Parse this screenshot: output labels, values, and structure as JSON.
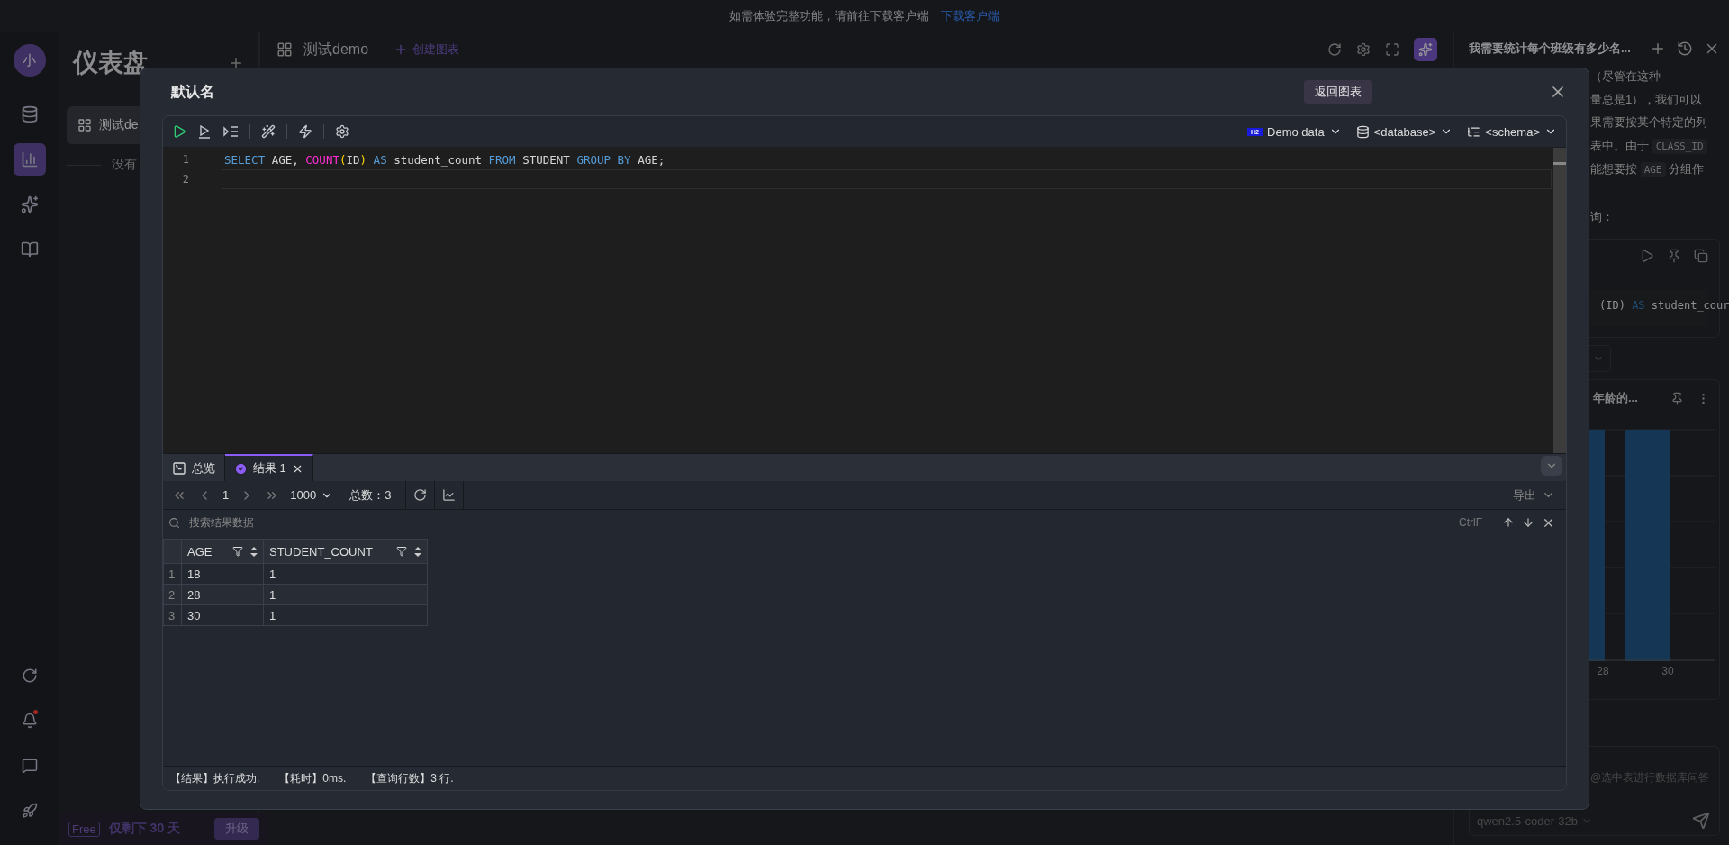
{
  "banner": {
    "text": "如需体验完整功能，请前往下载客户端",
    "link": "下载客户端"
  },
  "rail": {
    "avatar": "小",
    "items": [
      {
        "kind": "database",
        "selected": false
      },
      {
        "kind": "chart",
        "selected": true
      },
      {
        "kind": "assistant",
        "selected": false
      },
      {
        "kind": "book",
        "selected": false
      }
    ],
    "bottom_items": [
      {
        "kind": "refresh",
        "notification": false
      },
      {
        "kind": "bell",
        "notification": true
      },
      {
        "kind": "message",
        "notification": false
      },
      {
        "kind": "rocket",
        "notification": false
      }
    ]
  },
  "sidebar": {
    "title": "仪表盘",
    "items": [
      {
        "label": "测试de",
        "selected": true
      }
    ],
    "empty_text": "没有",
    "plan": {
      "tag": "Free",
      "text": "仅剩下 30 天",
      "button": "升级"
    }
  },
  "header": {
    "title": "测试demo",
    "create": "创建图表"
  },
  "assistant": {
    "title": "我需要统计每个班级有多少名...",
    "message_lines": [
      [
        {
          "text": "（尽管在这种",
          "kind": "text"
        }
      ],
      [
        {
          "text": "量总是1），我们可以",
          "kind": "text"
        }
      ],
      [
        {
          "text": "果需要按某个特定的列",
          "kind": "text"
        }
      ],
      [
        {
          "text": "表中。由于 ",
          "kind": "text"
        },
        {
          "text": "CLASS_ID",
          "kind": "code"
        }
      ],
      [
        {
          "text": "能想要按 ",
          "kind": "text"
        },
        {
          "text": "AGE",
          "kind": "code"
        },
        {
          "text": " 分组作",
          "kind": "text"
        }
      ],
      [
        {
          "text": "询：",
          "kind": "text"
        }
      ]
    ],
    "snippet": [
      {
        "text": "(ID) ",
        "kind": "plain"
      },
      {
        "text": "AS",
        "kind": "keyword"
      },
      {
        "text": " student_cour",
        "kind": "plain"
      }
    ],
    "chart": {
      "title": "年龄的...",
      "x_labels": [
        "28",
        "30"
      ]
    },
    "input": {
      "placeholder": "@选中表进行数据库问答",
      "model": "qwen2.5-coder-32b"
    }
  },
  "modal": {
    "title": "默认名",
    "back_button": "返回图表",
    "datasource": {
      "badge": "H2",
      "name": "Demo data"
    },
    "database": "<database>",
    "schema": "<schema>",
    "code_lines": [
      {
        "number": "1",
        "current": false,
        "tokens": [
          {
            "text": "SELECT",
            "kind": "keyword"
          },
          {
            "text": " AGE, ",
            "kind": "plain"
          },
          {
            "text": "COUNT",
            "kind": "function"
          },
          {
            "text": "(",
            "kind": "paren"
          },
          {
            "text": "ID",
            "kind": "plain"
          },
          {
            "text": ")",
            "kind": "paren"
          },
          {
            "text": " AS",
            "kind": "keyword"
          },
          {
            "text": " student_count ",
            "kind": "plain"
          },
          {
            "text": "FROM",
            "kind": "keyword"
          },
          {
            "text": " STUDENT ",
            "kind": "plain"
          },
          {
            "text": "GROUP BY",
            "kind": "keyword"
          },
          {
            "text": " AGE;",
            "kind": "plain"
          }
        ]
      },
      {
        "number": "2",
        "current": true
      }
    ],
    "result_tabs": [
      {
        "label": "总览",
        "kind": "overview",
        "selected": false
      },
      {
        "label": "结果 1",
        "kind": "result",
        "selected": true
      }
    ],
    "pager": {
      "page": "1",
      "size": "1000",
      "total": "总数：3"
    },
    "export": "导出",
    "search": {
      "placeholder": "搜索结果数据",
      "shortcut": "CtrlF"
    },
    "table": {
      "columns": [
        "AGE",
        "STUDENT_COUNT"
      ],
      "rows": [
        {
          "index": "1",
          "cells": [
            "18",
            "1"
          ]
        },
        {
          "index": "2",
          "cells": [
            "28",
            "1"
          ]
        },
        {
          "index": "3",
          "cells": [
            "30",
            "1"
          ]
        }
      ]
    },
    "status": [
      "【结果】执行成功.",
      "【耗时】0ms.",
      "【查询行数】3 行."
    ]
  }
}
